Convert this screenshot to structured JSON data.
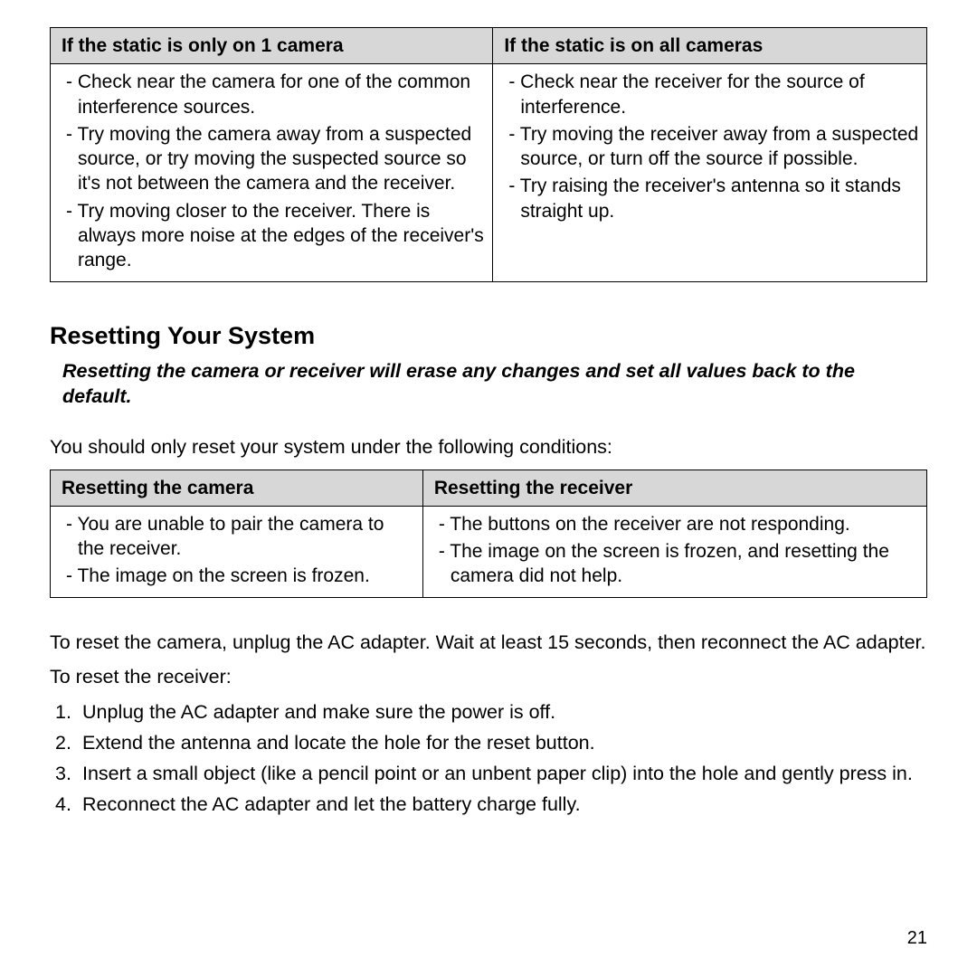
{
  "table1": {
    "header_left": "If the static is only on 1 camera",
    "header_right": "If the static is on all cameras",
    "left_items": [
      "Check near the camera for one of the common interference sources.",
      "Try moving the camera away from a suspected source, or try moving the suspected source so it's not between the camera and the receiver.",
      "Try moving closer to the receiver. There is always more noise at the edges of the receiver's range."
    ],
    "right_items": [
      "Check near the receiver for the source of interference.",
      "Try moving the receiver away from a suspected source, or turn off the source if possible.",
      "Try raising the receiver's antenna so it stands straight up."
    ]
  },
  "section_heading": "Resetting Your System",
  "section_note": "Resetting the camera or receiver will erase any changes and set all values back to the default.",
  "intro_text": "You should only reset your system under the following conditions:",
  "table2": {
    "header_left": "Resetting the camera",
    "header_right": "Resetting the receiver",
    "left_items": [
      "You are unable to pair the camera to the receiver.",
      "The image on the screen is frozen."
    ],
    "right_items": [
      "The buttons on the receiver are not responding.",
      "The image on the screen is frozen, and resetting the camera did not help."
    ]
  },
  "reset_camera_text": "To reset the camera, unplug the AC adapter. Wait at least 15 seconds, then reconnect the AC adapter.",
  "reset_receiver_intro": "To reset the receiver:",
  "reset_receiver_steps": [
    "Unplug the AC adapter and make sure the power is off.",
    "Extend the antenna and locate the hole for the reset button.",
    "Insert a small object (like a pencil point or an unbent paper clip) into the hole and gently press in.",
    "Reconnect the AC adapter and let the battery charge fully."
  ],
  "page_number": "21"
}
